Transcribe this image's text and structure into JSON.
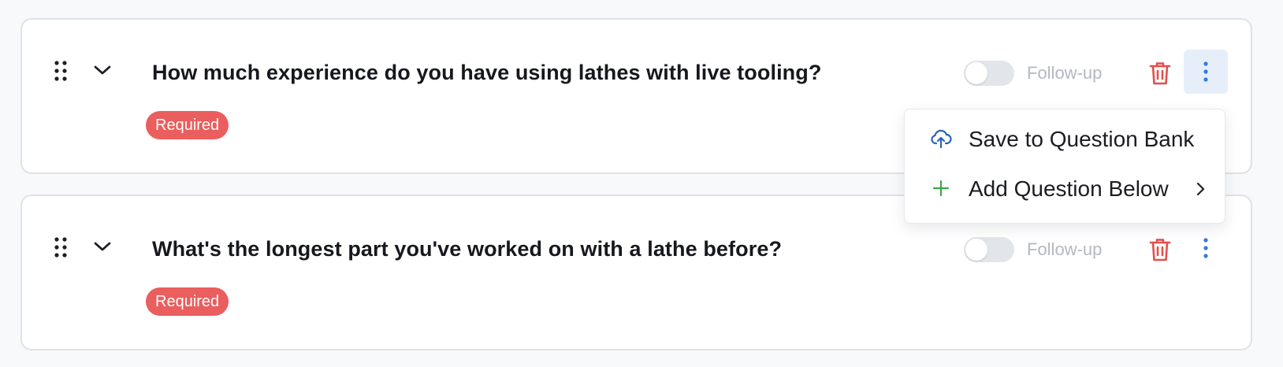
{
  "questions": [
    {
      "title": "How much experience do you have using lathes with live tooling?",
      "badge": "Required",
      "followup_label": "Follow-up",
      "followup_enabled": false,
      "menu_open": true
    },
    {
      "title": "What's the longest part you've worked on with a lathe before?",
      "badge": "Required",
      "followup_label": "Follow-up",
      "followup_enabled": false,
      "menu_open": false
    }
  ],
  "menu": {
    "items": [
      {
        "label": "Save to Question Bank",
        "icon": "cloud-upload-icon"
      },
      {
        "label": "Add Question Below",
        "icon": "plus-icon",
        "has_submenu": true
      }
    ]
  },
  "colors": {
    "required_badge": "#ea5e5e",
    "trash": "#e0504f",
    "more_dots": "#2f7be0",
    "cloud_icon": "#2a62b8",
    "plus_icon": "#3ca64a",
    "active_button_bg": "#e6eefa"
  }
}
